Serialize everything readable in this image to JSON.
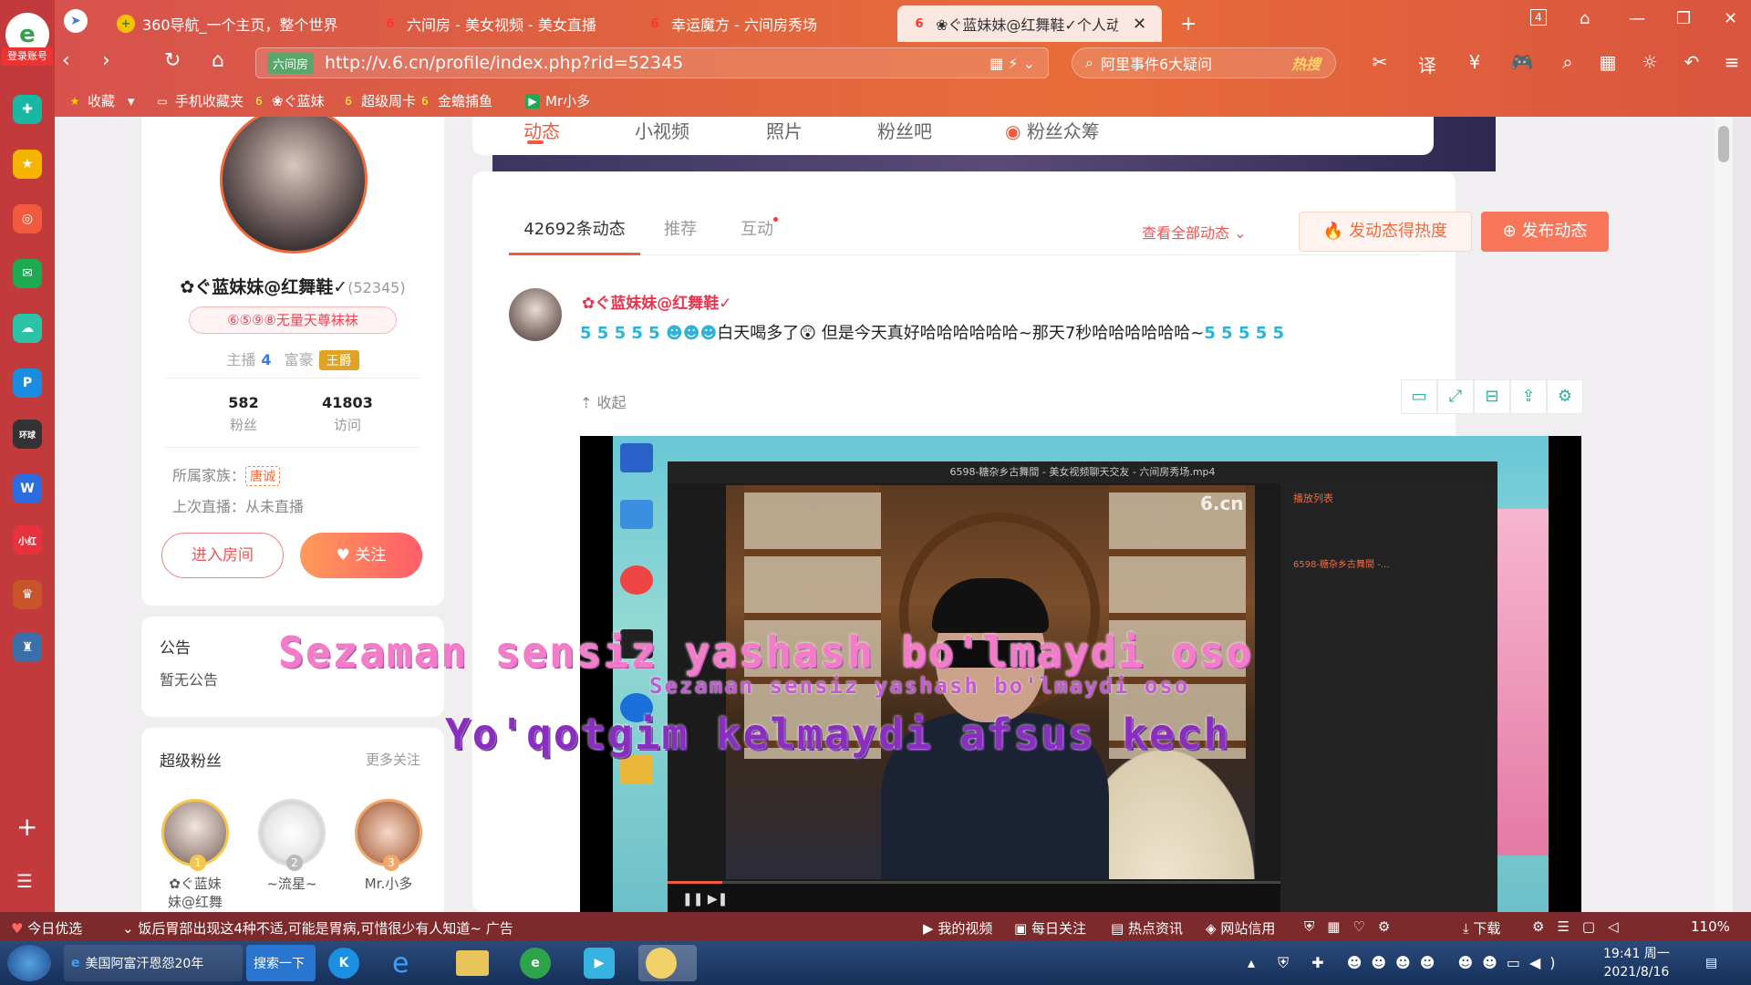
{
  "sidebar": {
    "login_label": "登录账号",
    "items": [
      "plus-circle",
      "star",
      "weibo",
      "mail",
      "cloud",
      "p-app",
      "game-box",
      "word",
      "red-app",
      "game",
      "game2"
    ]
  },
  "tabs": [
    {
      "label": "360导航_一个主页，整个世界"
    },
    {
      "label": "六间房 - 美女视频 - 美女直播"
    },
    {
      "label": "幸运魔方 - 六间房秀场"
    },
    {
      "label": "❀ぐ蓝妹妹@红舞鞋✓个人动态",
      "active": true
    }
  ],
  "tab_count": "4",
  "nav": {
    "url": "http://v.6.cn/profile/index.php?rid=52345",
    "site_badge": "六间房",
    "search_placeholder": "阿里事件6大疑问",
    "search_hot": "热搜"
  },
  "bookmarks": [
    "收藏",
    "手机收藏夹",
    "❀ぐ蓝妹",
    "超级周卡",
    "金蟾捕鱼",
    "Mr小多"
  ],
  "profile": {
    "name": "✿ぐ蓝妹妹@红舞鞋✓",
    "rid": "(52345)",
    "badge": "⑥⑤⑨⑧无量天尊袜袜",
    "anchor_label": "主播",
    "anchor_level": "4",
    "rich_label": "富豪",
    "rich_title": "王爵",
    "fans_count": "582",
    "fans_label": "粉丝",
    "visits_count": "41803",
    "visits_label": "访问",
    "family_label": "所属家族：",
    "family_tag": "唐诚",
    "last_live": "上次直播：从未直播",
    "enter_room": "进入房间",
    "follow": "关注"
  },
  "notice": {
    "title": "公告",
    "text": "暂无公告"
  },
  "super_fans": {
    "title": "超级粉丝",
    "more": "更多关注",
    "items": [
      {
        "name": "✿ぐ蓝妹\n妹@红舞",
        "rank": "1"
      },
      {
        "name": "~流星~",
        "rank": "2"
      },
      {
        "name": "Mr.小多",
        "rank": "3"
      }
    ]
  },
  "top_tabs": [
    "动态",
    "小视频",
    "照片",
    "粉丝吧",
    "粉丝众筹"
  ],
  "feed": {
    "tabs": [
      "42692条动态",
      "推荐",
      "互动"
    ],
    "view_all": "查看全部动态",
    "hot_button": "发动态得热度",
    "post_button": "发布动态",
    "post": {
      "author": "✿ぐ蓝妹妹@红舞鞋✓",
      "text_prefix": "白天喝多了",
      "text_main": "但是今天真好哈哈哈哈哈哈~那天7秒哈哈哈哈哈哈~",
      "collapse": "收起"
    }
  },
  "video": {
    "title": "6598-糖杂乡古舞間 - 美女视频聊天交友 - 六间房秀场.mp4",
    "logo": "6.cn",
    "progress": 0.09,
    "playlist_header": "播放列表",
    "playlist_item": "6598-糖杂乡古舞間 -...",
    "lyric_line1": "Sezaman sensiz yashash bo'lmaydi oso",
    "lyric_line2": "Yo'qotgim kelmaydi afsus kech"
  },
  "statusbar": {
    "today": "今日优选",
    "news": "饭后胃部出现这4种不适,可能是胃病,可惜很少有人知道~",
    "ad": "广告",
    "my_video": "我的视频",
    "daily": "每日关注",
    "hot": "热点资讯",
    "credit": "网站信用",
    "download": "下载",
    "zoom": "110%"
  },
  "taskbar": {
    "ie_task": "美国阿富汗恩怨20年",
    "search_btn": "搜索一下",
    "time": "19:41 周一",
    "date": "2021/8/16"
  }
}
